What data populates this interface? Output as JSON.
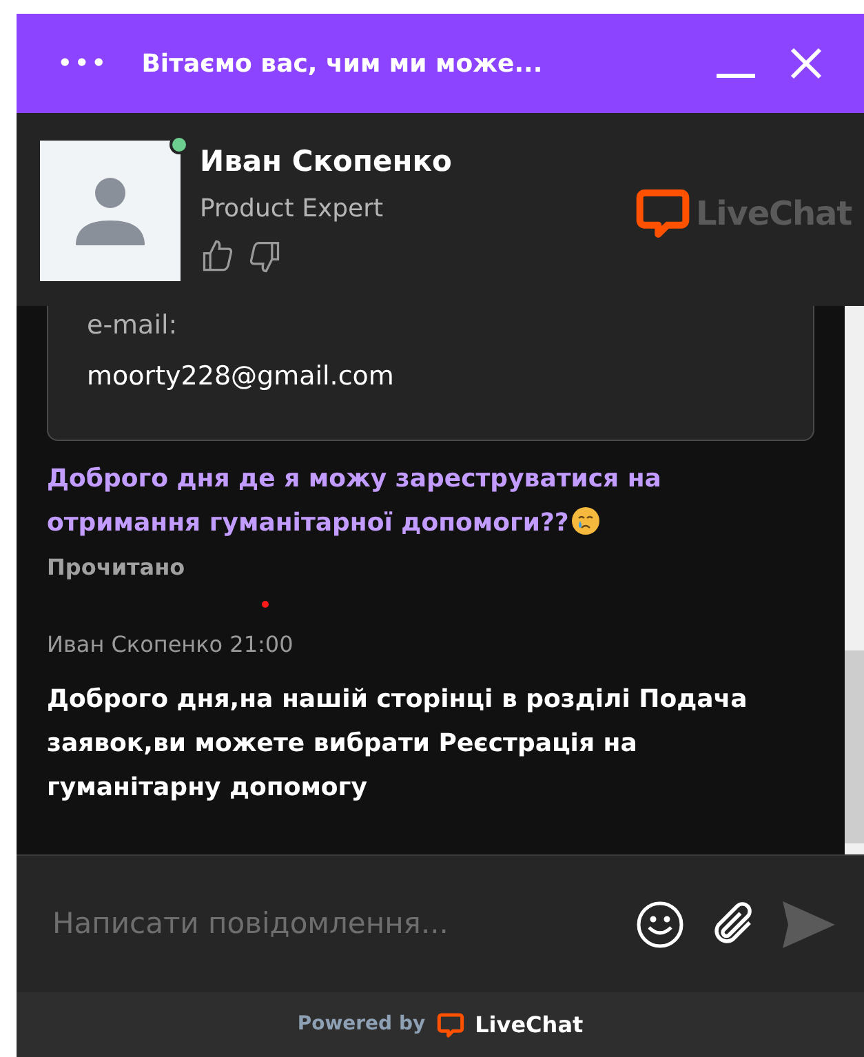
{
  "header": {
    "menu": "•••",
    "title": "Вітаємо вас, чим ми може..."
  },
  "agent": {
    "name": "Иван Скопенко",
    "role": "Product Expert",
    "online": true,
    "logo_text": "LiveChat"
  },
  "messages": [
    {
      "kind": "form",
      "label": "e-mail:",
      "value": "moorty228@gmail.com"
    },
    {
      "kind": "visitor",
      "text": "Доброго дня де я можу зареструватися на отримання гуманітарної допомоги??",
      "emoji": true,
      "status": "Прочитано"
    },
    {
      "kind": "agent",
      "author": "Иван Скопенко 21:00",
      "text": "Доброго дня,на нашій сторінці в розділі Подача заявок,ви можете вибрати Реєстрація на гуманітарну допомогу"
    }
  ],
  "composer": {
    "placeholder": "Написати повідомлення..."
  },
  "footer": {
    "powered": "Powered by",
    "brand": "LiveChat"
  }
}
